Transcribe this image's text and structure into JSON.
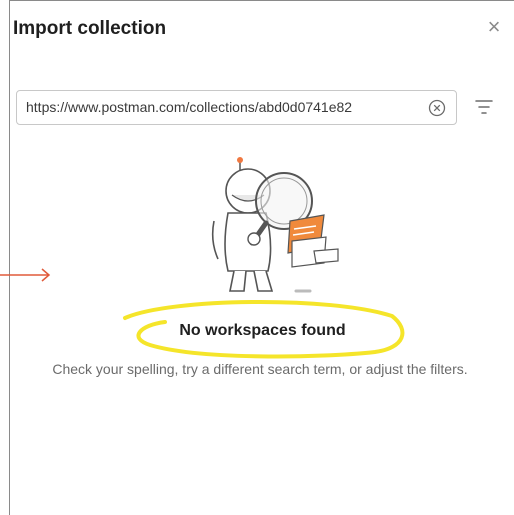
{
  "dialog": {
    "title": "Import collection",
    "close_glyph": "×"
  },
  "search": {
    "value": "https://www.postman.com/collections/abd0d0741e82",
    "clear_icon": "clear-circle-icon",
    "filter_icon": "filter-icon"
  },
  "empty_state": {
    "illustration": "astronaut-magnifier-illustration",
    "title": "No workspaces found",
    "description": "Check your spelling, try a different search term, or adjust the filters."
  },
  "annotations": {
    "highlight_color": "#f5e52a",
    "arrow_color": "#e05a3a"
  }
}
